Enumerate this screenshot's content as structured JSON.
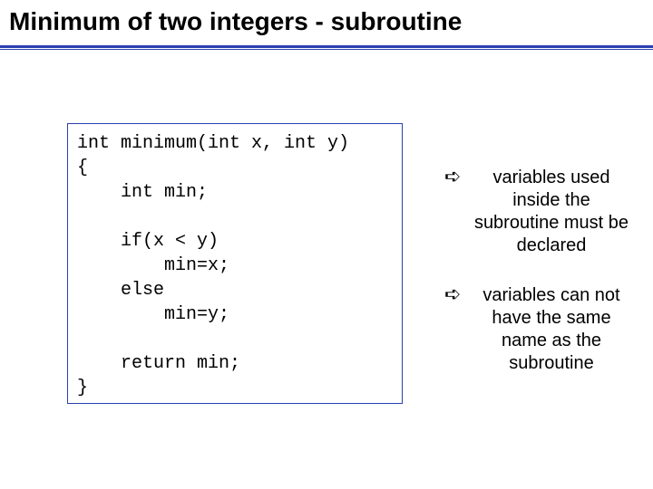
{
  "title": "Minimum of two integers - subroutine",
  "code": {
    "lines": [
      "int minimum(int x, int y)",
      "{",
      "    int min;",
      "",
      "    if(x < y)",
      "        min=x;",
      "    else",
      "        min=y;",
      "",
      "    return min;",
      "}"
    ]
  },
  "notes": [
    {
      "arrow": "➪",
      "text": "variables used inside the subroutine must be declared"
    },
    {
      "arrow": "➪",
      "text": "variables can not have the same name as the subroutine"
    }
  ]
}
